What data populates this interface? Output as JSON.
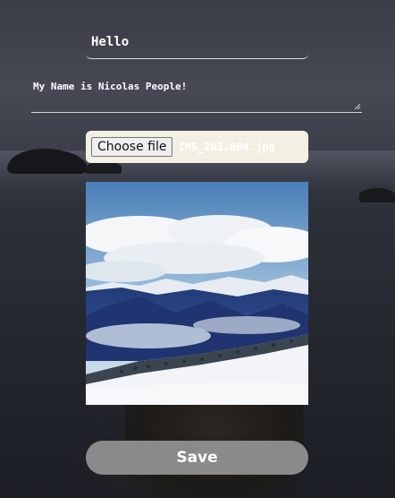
{
  "profile_form": {
    "name_value": "Hello",
    "bio_value": "My Name is Nicolas People!",
    "file_button_label": "Choose file",
    "file_name": "IMG_201…004.jpg",
    "save_label": "Save"
  },
  "icons": {
    "resize_handle": "resize-handle-icon"
  },
  "colors": {
    "save_button": "#8a8a8a",
    "file_row_background": "#f3efe2",
    "field_underline": "#d8d8d8"
  }
}
